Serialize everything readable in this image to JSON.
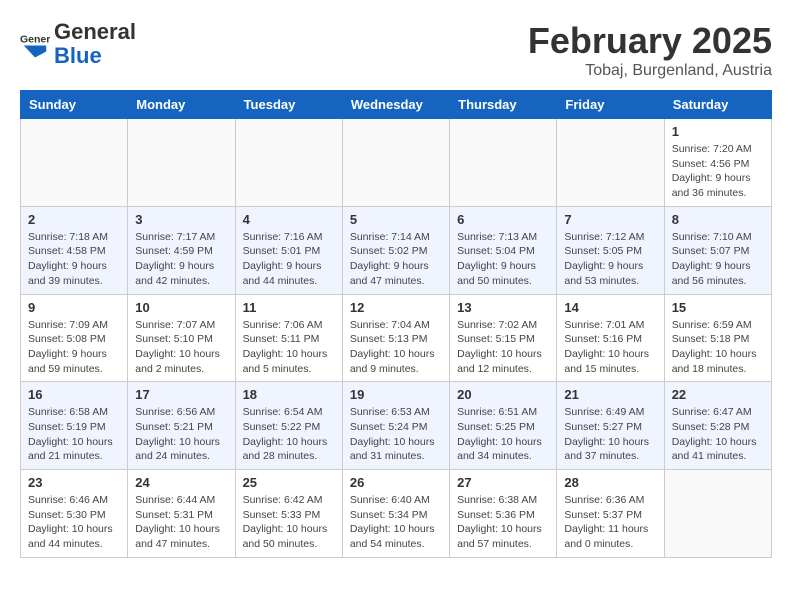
{
  "logo": {
    "text_general": "General",
    "text_blue": "Blue"
  },
  "header": {
    "month": "February 2025",
    "location": "Tobaj, Burgenland, Austria"
  },
  "weekdays": [
    "Sunday",
    "Monday",
    "Tuesday",
    "Wednesday",
    "Thursday",
    "Friday",
    "Saturday"
  ],
  "weeks": [
    [
      {
        "day": "",
        "info": ""
      },
      {
        "day": "",
        "info": ""
      },
      {
        "day": "",
        "info": ""
      },
      {
        "day": "",
        "info": ""
      },
      {
        "day": "",
        "info": ""
      },
      {
        "day": "",
        "info": ""
      },
      {
        "day": "1",
        "info": "Sunrise: 7:20 AM\nSunset: 4:56 PM\nDaylight: 9 hours and 36 minutes."
      }
    ],
    [
      {
        "day": "2",
        "info": "Sunrise: 7:18 AM\nSunset: 4:58 PM\nDaylight: 9 hours and 39 minutes."
      },
      {
        "day": "3",
        "info": "Sunrise: 7:17 AM\nSunset: 4:59 PM\nDaylight: 9 hours and 42 minutes."
      },
      {
        "day": "4",
        "info": "Sunrise: 7:16 AM\nSunset: 5:01 PM\nDaylight: 9 hours and 44 minutes."
      },
      {
        "day": "5",
        "info": "Sunrise: 7:14 AM\nSunset: 5:02 PM\nDaylight: 9 hours and 47 minutes."
      },
      {
        "day": "6",
        "info": "Sunrise: 7:13 AM\nSunset: 5:04 PM\nDaylight: 9 hours and 50 minutes."
      },
      {
        "day": "7",
        "info": "Sunrise: 7:12 AM\nSunset: 5:05 PM\nDaylight: 9 hours and 53 minutes."
      },
      {
        "day": "8",
        "info": "Sunrise: 7:10 AM\nSunset: 5:07 PM\nDaylight: 9 hours and 56 minutes."
      }
    ],
    [
      {
        "day": "9",
        "info": "Sunrise: 7:09 AM\nSunset: 5:08 PM\nDaylight: 9 hours and 59 minutes."
      },
      {
        "day": "10",
        "info": "Sunrise: 7:07 AM\nSunset: 5:10 PM\nDaylight: 10 hours and 2 minutes."
      },
      {
        "day": "11",
        "info": "Sunrise: 7:06 AM\nSunset: 5:11 PM\nDaylight: 10 hours and 5 minutes."
      },
      {
        "day": "12",
        "info": "Sunrise: 7:04 AM\nSunset: 5:13 PM\nDaylight: 10 hours and 9 minutes."
      },
      {
        "day": "13",
        "info": "Sunrise: 7:02 AM\nSunset: 5:15 PM\nDaylight: 10 hours and 12 minutes."
      },
      {
        "day": "14",
        "info": "Sunrise: 7:01 AM\nSunset: 5:16 PM\nDaylight: 10 hours and 15 minutes."
      },
      {
        "day": "15",
        "info": "Sunrise: 6:59 AM\nSunset: 5:18 PM\nDaylight: 10 hours and 18 minutes."
      }
    ],
    [
      {
        "day": "16",
        "info": "Sunrise: 6:58 AM\nSunset: 5:19 PM\nDaylight: 10 hours and 21 minutes."
      },
      {
        "day": "17",
        "info": "Sunrise: 6:56 AM\nSunset: 5:21 PM\nDaylight: 10 hours and 24 minutes."
      },
      {
        "day": "18",
        "info": "Sunrise: 6:54 AM\nSunset: 5:22 PM\nDaylight: 10 hours and 28 minutes."
      },
      {
        "day": "19",
        "info": "Sunrise: 6:53 AM\nSunset: 5:24 PM\nDaylight: 10 hours and 31 minutes."
      },
      {
        "day": "20",
        "info": "Sunrise: 6:51 AM\nSunset: 5:25 PM\nDaylight: 10 hours and 34 minutes."
      },
      {
        "day": "21",
        "info": "Sunrise: 6:49 AM\nSunset: 5:27 PM\nDaylight: 10 hours and 37 minutes."
      },
      {
        "day": "22",
        "info": "Sunrise: 6:47 AM\nSunset: 5:28 PM\nDaylight: 10 hours and 41 minutes."
      }
    ],
    [
      {
        "day": "23",
        "info": "Sunrise: 6:46 AM\nSunset: 5:30 PM\nDaylight: 10 hours and 44 minutes."
      },
      {
        "day": "24",
        "info": "Sunrise: 6:44 AM\nSunset: 5:31 PM\nDaylight: 10 hours and 47 minutes."
      },
      {
        "day": "25",
        "info": "Sunrise: 6:42 AM\nSunset: 5:33 PM\nDaylight: 10 hours and 50 minutes."
      },
      {
        "day": "26",
        "info": "Sunrise: 6:40 AM\nSunset: 5:34 PM\nDaylight: 10 hours and 54 minutes."
      },
      {
        "day": "27",
        "info": "Sunrise: 6:38 AM\nSunset: 5:36 PM\nDaylight: 10 hours and 57 minutes."
      },
      {
        "day": "28",
        "info": "Sunrise: 6:36 AM\nSunset: 5:37 PM\nDaylight: 11 hours and 0 minutes."
      },
      {
        "day": "",
        "info": ""
      }
    ]
  ]
}
